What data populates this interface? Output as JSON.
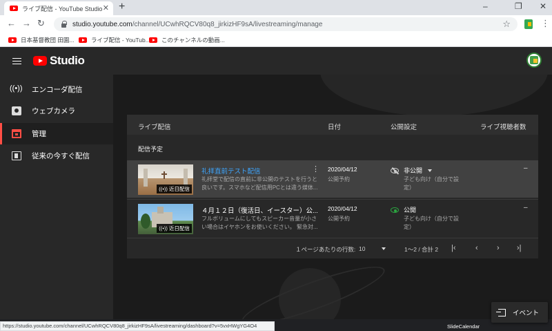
{
  "browser": {
    "tab_title": "ライブ配信 - YouTube Studio",
    "tab_close": "✕",
    "new_tab": "+",
    "win_min": "–",
    "win_max": "❐",
    "win_close": "✕",
    "nav_back": "←",
    "nav_forward": "→",
    "nav_reload": "↻",
    "url_host": "studio.youtube.com",
    "url_path": "/channel/UCwhRQCV80q8_jirkizHF9sA/livestreaming/manage",
    "star": "☆",
    "menu": "⋮",
    "bookmarks": [
      "日本基督教団 田園...",
      "ライブ配信 - YouTub...",
      "このチャンネルの動画..."
    ]
  },
  "header": {
    "logo_text": "Studio"
  },
  "sidebar": {
    "items": [
      {
        "label": "エンコーダ配信",
        "icon": "broadcast-icon",
        "glyph": "((•))"
      },
      {
        "label": "ウェブカメラ",
        "icon": "camera-icon"
      },
      {
        "label": "管理",
        "icon": "calendar-icon"
      },
      {
        "label": "従来の今すぐ配信",
        "icon": "exit-icon"
      }
    ]
  },
  "table": {
    "headers": {
      "stream": "ライブ配信",
      "date": "日付",
      "visibility": "公開設定",
      "viewers": "ライブ視聴者数"
    },
    "section": "配信予定",
    "rows": [
      {
        "badge": "((•)) 近日配信",
        "title": "礼拝直前テスト配信",
        "desc": "礼拝堂で配信の直前に非公開のテストを行うと良いです。スマホなど配信用PCとは違う媒体...",
        "kebab": "⋮",
        "date": "2020/04/12",
        "date_sub": "公開予約",
        "visibility": "非公開",
        "visibility_sub": "子ども向け（自分で設定）",
        "viewers": "–"
      },
      {
        "badge": "((•)) 近日配信",
        "title": "４月１２日（復活日、イースター）公...",
        "desc": "フルボリュームにしてもスピーカー音量が小さい場合はイヤホンをお使いください。 緊急対...",
        "date": "2020/04/12",
        "date_sub": "公開予約",
        "visibility": "公開",
        "visibility_sub": "子ども向け（自分で設定）",
        "viewers": "–"
      }
    ]
  },
  "pager": {
    "rows_label": "１ページあたりの行数:",
    "rows_value": "10",
    "range": "1～2 / 合計 2",
    "first": "|‹",
    "prev": "‹",
    "next": "›",
    "last": "›|"
  },
  "event_button": "イベント",
  "status_url": "https://studio.youtube.com/channel/UCwhRQCV80q8_jirkizHF9sA/livestreaming/dashboard?v=5vxHWgYG4O4",
  "watermark": "SlideCalendar",
  "colors": {
    "accent_red": "#ff4e45",
    "link_blue": "#3ea6ff",
    "public_green": "#2ba640"
  }
}
